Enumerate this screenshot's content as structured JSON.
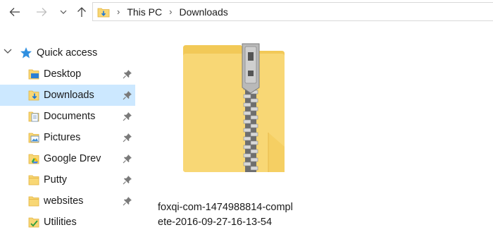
{
  "nav": {
    "back_icon": "back-arrow-icon",
    "forward_icon": "forward-arrow-icon",
    "recent_icon": "chevron-down-icon",
    "up_icon": "up-arrow-icon"
  },
  "address": {
    "crumbs": [
      "This PC",
      "Downloads"
    ]
  },
  "sidebar": {
    "quick_access": "Quick access",
    "items": [
      {
        "label": "Desktop",
        "pinned": true
      },
      {
        "label": "Downloads",
        "pinned": true,
        "selected": true
      },
      {
        "label": "Documents",
        "pinned": true
      },
      {
        "label": "Pictures",
        "pinned": true
      },
      {
        "label": "Google Drev",
        "pinned": true
      },
      {
        "label": "Putty",
        "pinned": true
      },
      {
        "label": "websites",
        "pinned": true
      },
      {
        "label": "Utilities",
        "pinned": false
      }
    ]
  },
  "content": {
    "file": {
      "name_line1": "foxqi-com-1474988814-compl",
      "name_line2": "ete-2016-09-27-16-13-54",
      "icon": "zip-folder-icon"
    }
  },
  "colors": {
    "selection": "#cce8ff",
    "folder": "#f8d775",
    "accent": "#1e90ff"
  }
}
